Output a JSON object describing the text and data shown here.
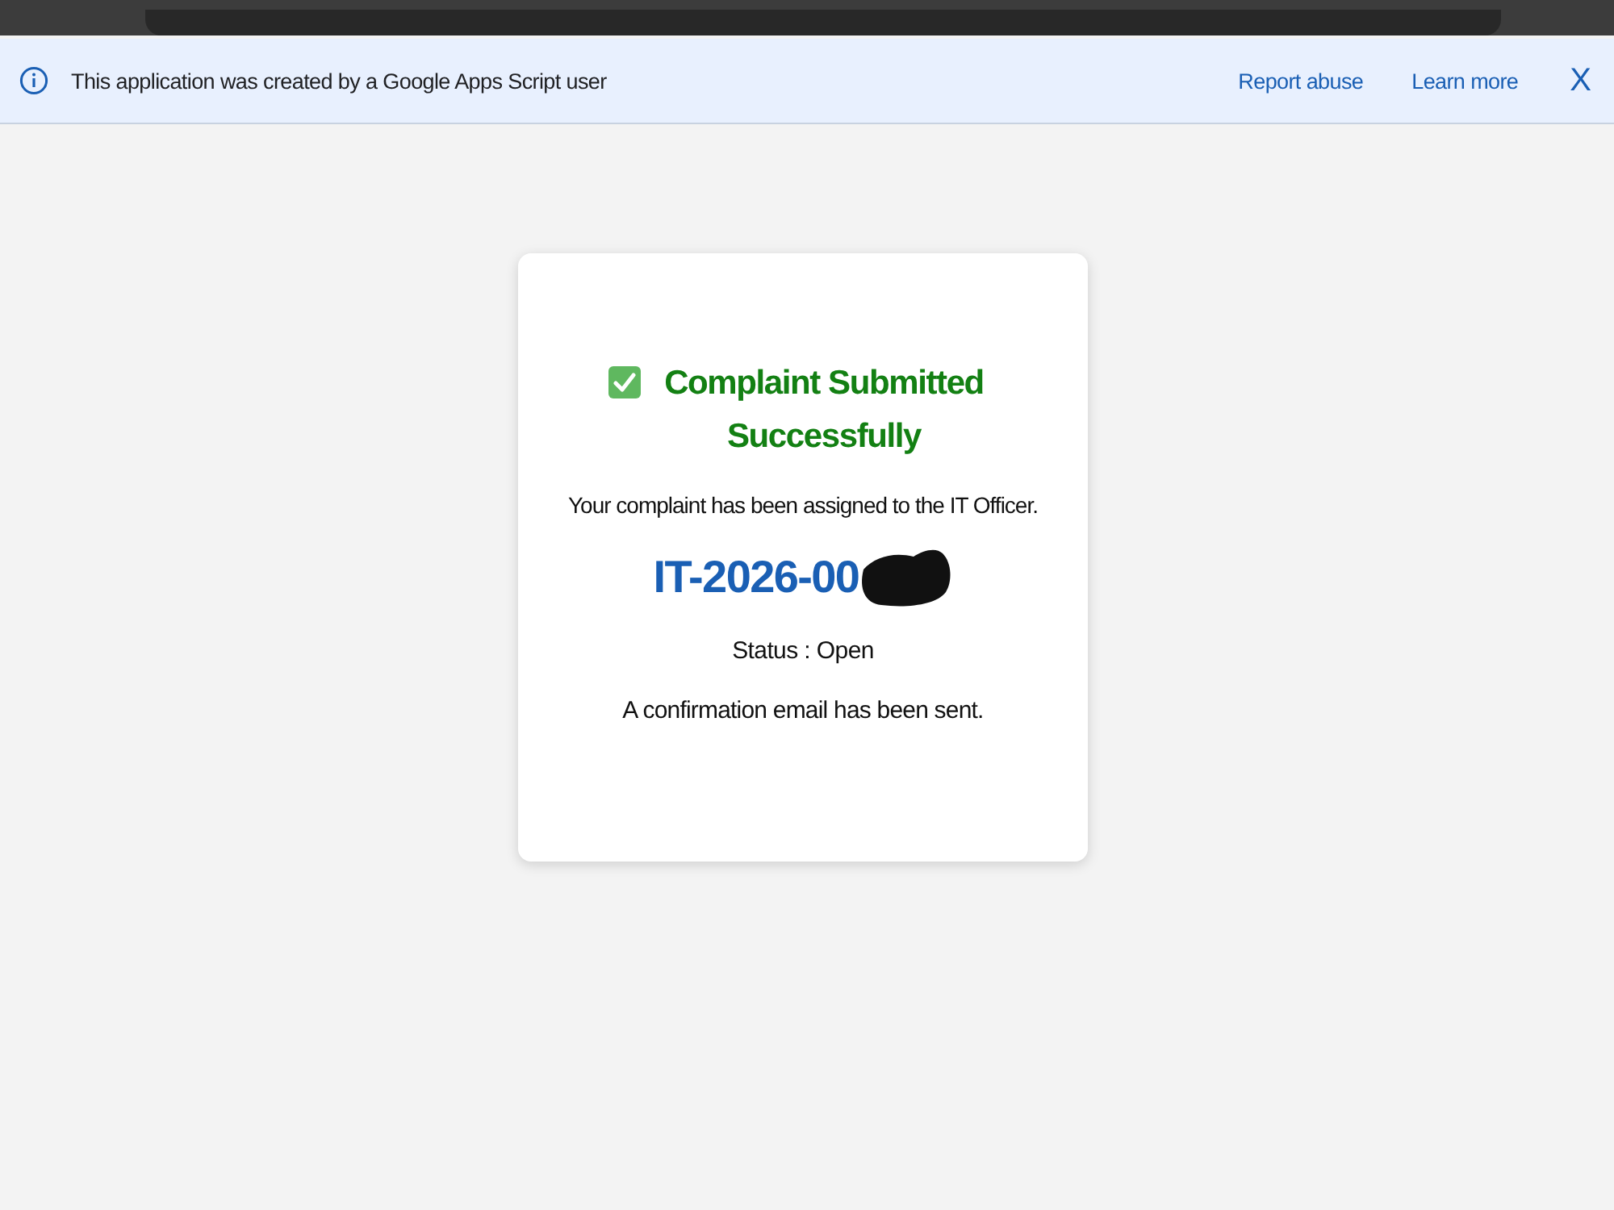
{
  "banner": {
    "message": "This application was created by a Google Apps Script user",
    "links": [
      "Report abuse",
      "Learn more"
    ],
    "close": "X"
  },
  "card": {
    "title": "Complaint Submitted Successfully",
    "message": "Your complaint has been assigned to the IT Officer.",
    "ticket_id": "IT-2026-00",
    "status": "Status : Open",
    "note": "A confirmation email has been sent."
  }
}
